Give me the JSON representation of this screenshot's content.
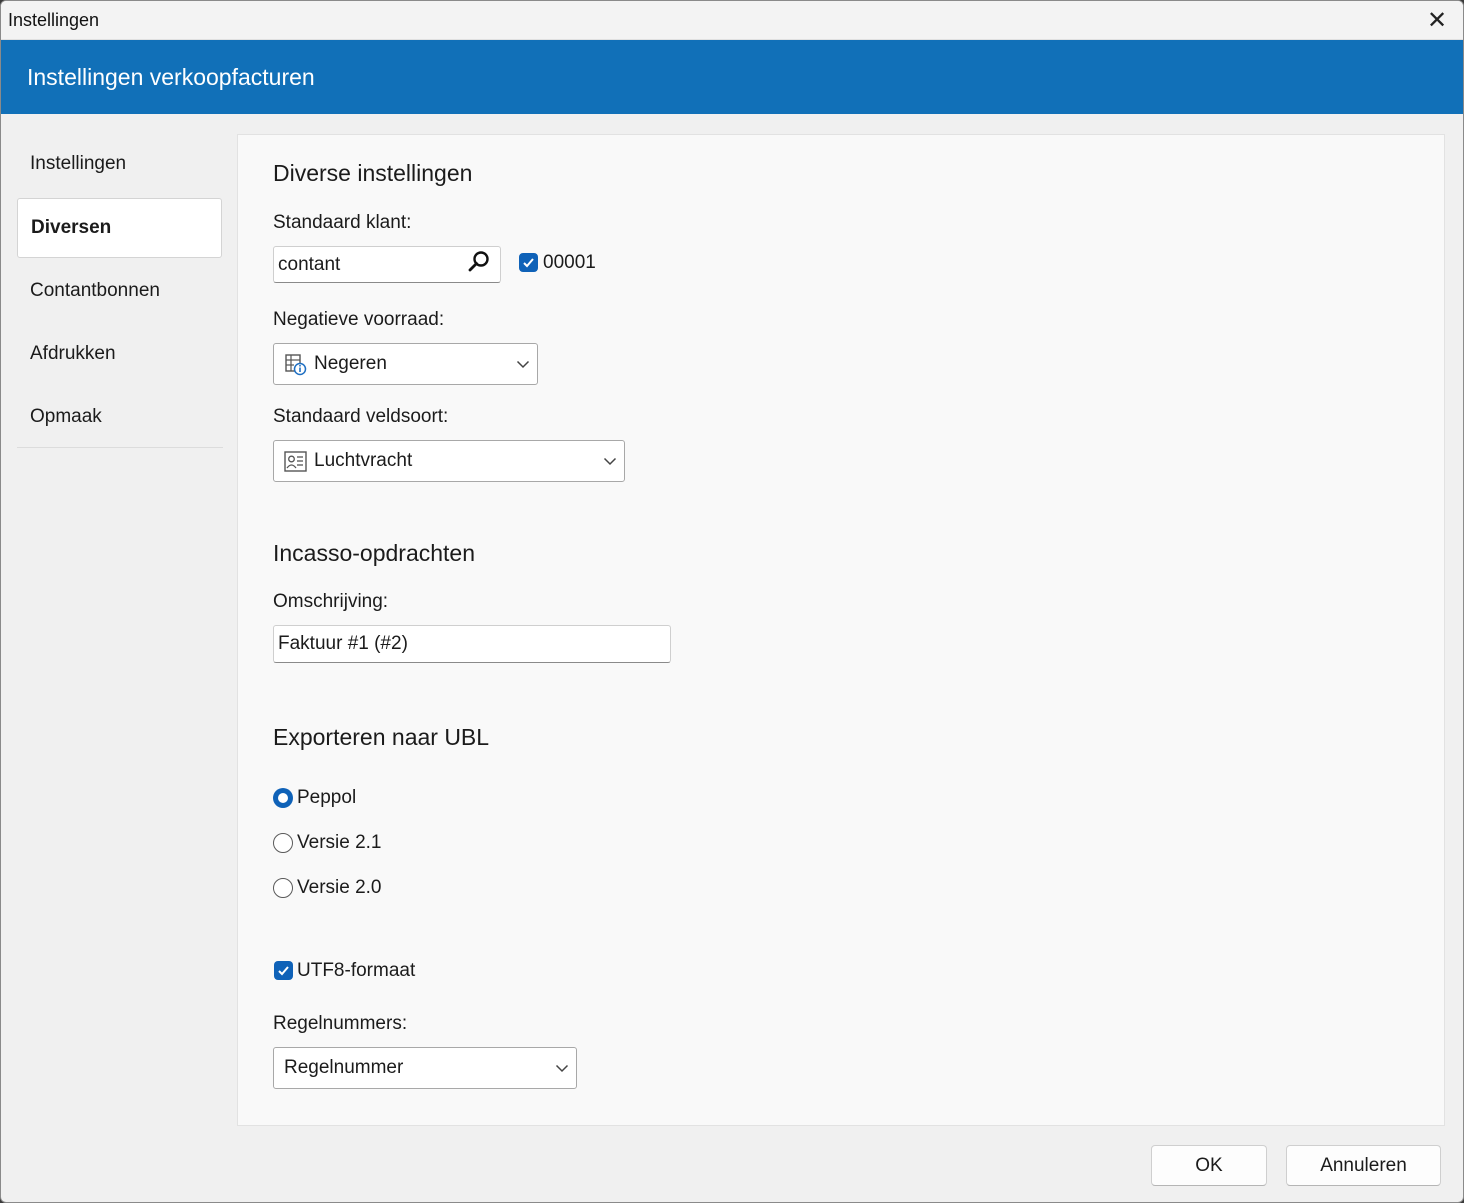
{
  "window": {
    "title": "Instellingen",
    "close_glyph": "✕"
  },
  "banner": {
    "heading": "Instellingen verkoopfacturen"
  },
  "sidebar": {
    "items": [
      {
        "label": "Instellingen",
        "active": false
      },
      {
        "label": "Diversen",
        "active": true
      },
      {
        "label": "Contantbonnen",
        "active": false
      },
      {
        "label": "Afdrukken",
        "active": false
      },
      {
        "label": "Opmaak",
        "active": false
      }
    ]
  },
  "diverse": {
    "section_title": "Diverse instellingen",
    "standaard_klant_label": "Standaard klant:",
    "standaard_klant_value": "contant",
    "klant_code_label": "00001",
    "klant_code_checked": true,
    "negatieve_voorraad_label": "Negatieve voorraad:",
    "negatieve_voorraad_value": "Negeren",
    "negatieve_voorraad_icon": "stock-info-icon",
    "veldsoort_label": "Standaard veldsoort:",
    "veldsoort_value": "Luchtvracht",
    "veldsoort_icon": "contact-card-icon"
  },
  "incasso": {
    "section_title": "Incasso-opdrachten",
    "omschrijving_label": "Omschrijving:",
    "omschrijving_value": "Faktuur #1 (#2)"
  },
  "ubl": {
    "section_title": "Exporteren naar UBL",
    "options": [
      {
        "label": "Peppol",
        "selected": true
      },
      {
        "label": "Versie 2.1",
        "selected": false
      },
      {
        "label": "Versie 2.0",
        "selected": false
      }
    ],
    "utf8_label": "UTF8-formaat",
    "utf8_checked": true,
    "regelnummers_label": "Regelnummers:",
    "regelnummers_value": "Regelnummer"
  },
  "footer": {
    "ok_label": "OK",
    "cancel_label": "Annuleren"
  },
  "colors": {
    "banner": "#1170b8",
    "accent": "#0f62b8"
  }
}
